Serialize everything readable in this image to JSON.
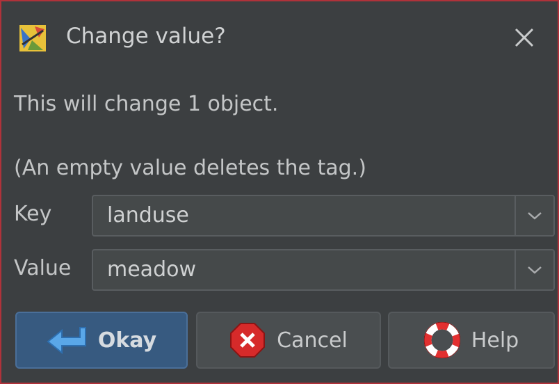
{
  "dialog": {
    "title": "Change value?",
    "message": "This will change 1 object.",
    "hint": "(An empty value deletes the tag.)"
  },
  "fields": {
    "key_label": "Key",
    "key_value": "landuse",
    "value_label": "Value",
    "value_value": "meadow"
  },
  "buttons": {
    "okay": "Okay",
    "cancel": "Cancel",
    "help": "Help"
  },
  "icons": {
    "app": "josm-app-icon",
    "close": "close-icon",
    "okay": "okay-arrow-icon",
    "cancel": "cancel-x-icon",
    "help": "lifebuoy-help-icon",
    "dropdown": "chevron-down-icon"
  },
  "colors": {
    "background": "#3c3f41",
    "border": "#b0323a",
    "primary_button": "#375a80",
    "cancel_red": "#d62a2a"
  }
}
